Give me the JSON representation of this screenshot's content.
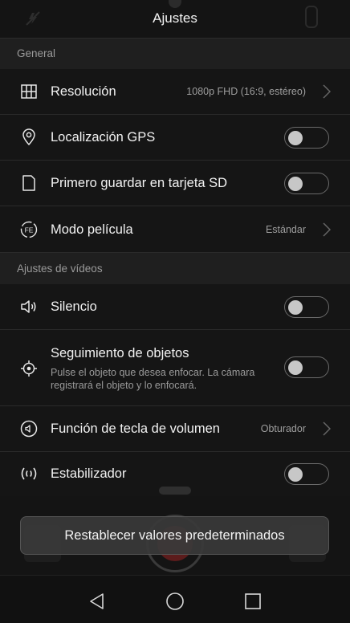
{
  "header": {
    "title": "Ajustes"
  },
  "sections": {
    "general": "General",
    "videos": "Ajustes de vídeos"
  },
  "settings": {
    "resolution": {
      "label": "Resolución",
      "value": "1080p FHD (16:9, estéreo)",
      "icon": "grid-icon"
    },
    "gps": {
      "label": "Localización GPS",
      "enabled": false,
      "icon": "location-pin-icon"
    },
    "sd": {
      "label": "Primero guardar en tarjeta SD",
      "enabled": false,
      "icon": "sd-card-icon"
    },
    "film_mode": {
      "label": "Modo película",
      "value": "Estándar",
      "icon": "film-mode-icon"
    },
    "mute": {
      "label": "Silencio",
      "enabled": false,
      "icon": "speaker-icon"
    },
    "tracking": {
      "label": "Seguimiento de objetos",
      "description": "Pulse el objeto que desea enfocar. La cámara registrará el objeto y lo enfocará.",
      "enabled": false,
      "icon": "target-icon"
    },
    "volume_key": {
      "label": "Función de tecla de volumen",
      "value": "Obturador",
      "icon": "volume-key-icon"
    },
    "stabilizer": {
      "label": "Estabilizador",
      "enabled": false,
      "icon": "stabilizer-icon"
    }
  },
  "reset_button": {
    "label": "Restablecer valores predeterminados"
  },
  "navbar": {
    "back": "back-triangle-icon",
    "home": "home-circle-icon",
    "recents": "recents-square-icon"
  },
  "colors": {
    "background": "#151515",
    "section": "#1f1f1f",
    "text": "#f2f2f2",
    "secondary": "#9e9e9e"
  }
}
